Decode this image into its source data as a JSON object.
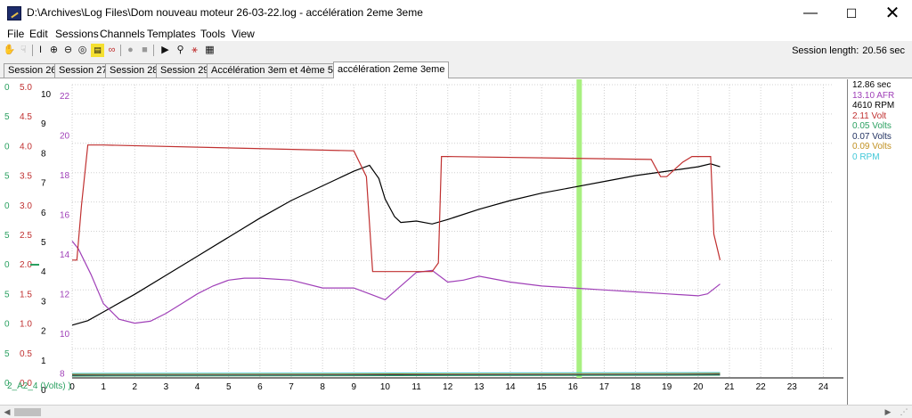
{
  "window": {
    "title": "D:\\Archives\\Log Files\\Dom nouveau moteur 26-03-22.log - accélération 2eme 3eme",
    "minimize": "—",
    "maximize": "☐",
    "close": "✕"
  },
  "menu": [
    "File",
    "Edit",
    "Sessions",
    "Channels",
    "Templates",
    "Tools",
    "View"
  ],
  "toolbar": {
    "icons": [
      "hand-icon",
      "pan-icon",
      "cursor-icon",
      "zoom-in-icon",
      "zoom-out-icon",
      "zoom-fit-icon",
      "note-icon",
      "binoculars-icon",
      "record-icon",
      "stop-icon",
      "play-icon",
      "find-icon",
      "chart-icon",
      "grid-icon"
    ],
    "session_length_label": "Session length:",
    "session_length_value": "20.56 sec"
  },
  "tabs": [
    {
      "label": "Session 26",
      "active": false
    },
    {
      "label": "Session 27",
      "active": false
    },
    {
      "label": "Session 28",
      "active": false
    },
    {
      "label": "Session 29",
      "active": false
    },
    {
      "label": "Accélération 3em et 4ème 5000",
      "active": false
    },
    {
      "label": "accélération 2eme 3eme",
      "active": true
    }
  ],
  "plot": {
    "x_ticks": [
      "0",
      "1",
      "2",
      "3",
      "4",
      "5",
      "6",
      "7",
      "8",
      "9",
      "10",
      "11",
      "12",
      "13",
      "14",
      "15",
      "16",
      "17",
      "18",
      "19",
      "20",
      "21",
      "22",
      "23",
      "24"
    ],
    "cursor_time": 16.2,
    "bottom_label": "2_A2_4 (Volts) )",
    "axis_green": [
      "0",
      "5",
      "0",
      "5",
      "0",
      "5",
      "0",
      "5",
      "0",
      "5",
      "0",
      "5"
    ],
    "axis_red": [
      "5.0",
      "4.5",
      "4.0",
      "3.5",
      "3.0",
      "2.5",
      "2.0",
      "1.5",
      "1.0",
      "0.5",
      "0.0"
    ],
    "axis_black": [
      "10",
      "9",
      "8",
      "7",
      "6",
      "5",
      "4",
      "3",
      "2",
      "1",
      "0"
    ],
    "axis_purple": [
      "22",
      "20",
      "18",
      "16",
      "14",
      "12",
      "10",
      "8"
    ]
  },
  "chart_data": {
    "type": "line",
    "xlabel": "",
    "x_range": [
      0,
      24.3
    ],
    "grid": true,
    "series": [
      {
        "name": "RPM",
        "color": "#000000",
        "axis": [
          0,
          10
        ],
        "x": [
          0,
          0.5,
          1,
          2,
          3,
          4,
          5,
          6,
          7,
          8,
          9,
          9.5,
          9.8,
          10,
          10.3,
          10.5,
          11,
          11.5,
          12,
          13,
          14,
          15,
          16,
          17,
          18,
          19,
          20,
          20.4,
          20.7
        ],
        "y": [
          1.8,
          1.95,
          2.25,
          2.85,
          3.5,
          4.15,
          4.8,
          5.45,
          6.05,
          6.55,
          7.05,
          7.25,
          6.8,
          6.1,
          5.5,
          5.3,
          5.35,
          5.25,
          5.4,
          5.75,
          6.05,
          6.3,
          6.5,
          6.7,
          6.9,
          7.05,
          7.2,
          7.3,
          7.2
        ]
      },
      {
        "name": "AFR",
        "color": "#a040b8",
        "axis": [
          8,
          23
        ],
        "x": [
          0,
          0.2,
          0.6,
          1,
          1.5,
          2,
          2.5,
          3,
          3.5,
          4,
          4.5,
          5,
          5.5,
          6,
          7,
          8,
          9,
          9.5,
          10,
          10.5,
          11,
          11.5,
          12,
          12.5,
          13,
          14,
          15,
          16,
          17,
          18,
          19,
          20,
          20.3,
          20.7
        ],
        "y": [
          15.0,
          14.6,
          13.3,
          11.8,
          11.0,
          10.8,
          10.9,
          11.3,
          11.8,
          12.3,
          12.7,
          13.0,
          13.1,
          13.1,
          13.0,
          12.6,
          12.6,
          12.3,
          12.0,
          12.7,
          13.4,
          13.5,
          12.9,
          13.0,
          13.2,
          12.9,
          12.7,
          12.6,
          12.5,
          12.4,
          12.3,
          12.2,
          12.3,
          12.8
        ]
      },
      {
        "name": "Volt",
        "color": "#c03030",
        "axis": [
          0,
          5.1
        ],
        "x": [
          0,
          0.15,
          0.3,
          0.5,
          1,
          9,
          9.4,
          9.6,
          11.5,
          11.7,
          11.8,
          12,
          18.5,
          18.8,
          19,
          19.5,
          19.8,
          20.4,
          20.5,
          20.7
        ],
        "y": [
          2.05,
          2.05,
          3.0,
          4.05,
          4.05,
          3.95,
          3.5,
          1.85,
          1.85,
          2.0,
          3.85,
          3.85,
          3.8,
          3.5,
          3.5,
          3.75,
          3.85,
          3.85,
          2.5,
          2.05
        ]
      }
    ]
  },
  "legend": [
    {
      "label": "12.86 sec",
      "color": "#000000"
    },
    {
      "label": "13.10 AFR",
      "color": "#a040b8"
    },
    {
      "label": "4610 RPM",
      "color": "#000000"
    },
    {
      "label": "2.11 Volt",
      "color": "#c03030"
    },
    {
      "label": "0.05 Volts",
      "color": "#2aa060"
    },
    {
      "label": "0.07 Volts",
      "color": "#203060"
    },
    {
      "label": "0.09 Volts",
      "color": "#c09020"
    },
    {
      "label": "0 RPM",
      "color": "#40c8d8"
    }
  ],
  "colors": {
    "axis_green": "#2aa060",
    "axis_red": "#c03030",
    "axis_black": "#000000",
    "axis_purple": "#a040b8",
    "cursor": "#a8f080",
    "grid": "#d0d0d0"
  }
}
